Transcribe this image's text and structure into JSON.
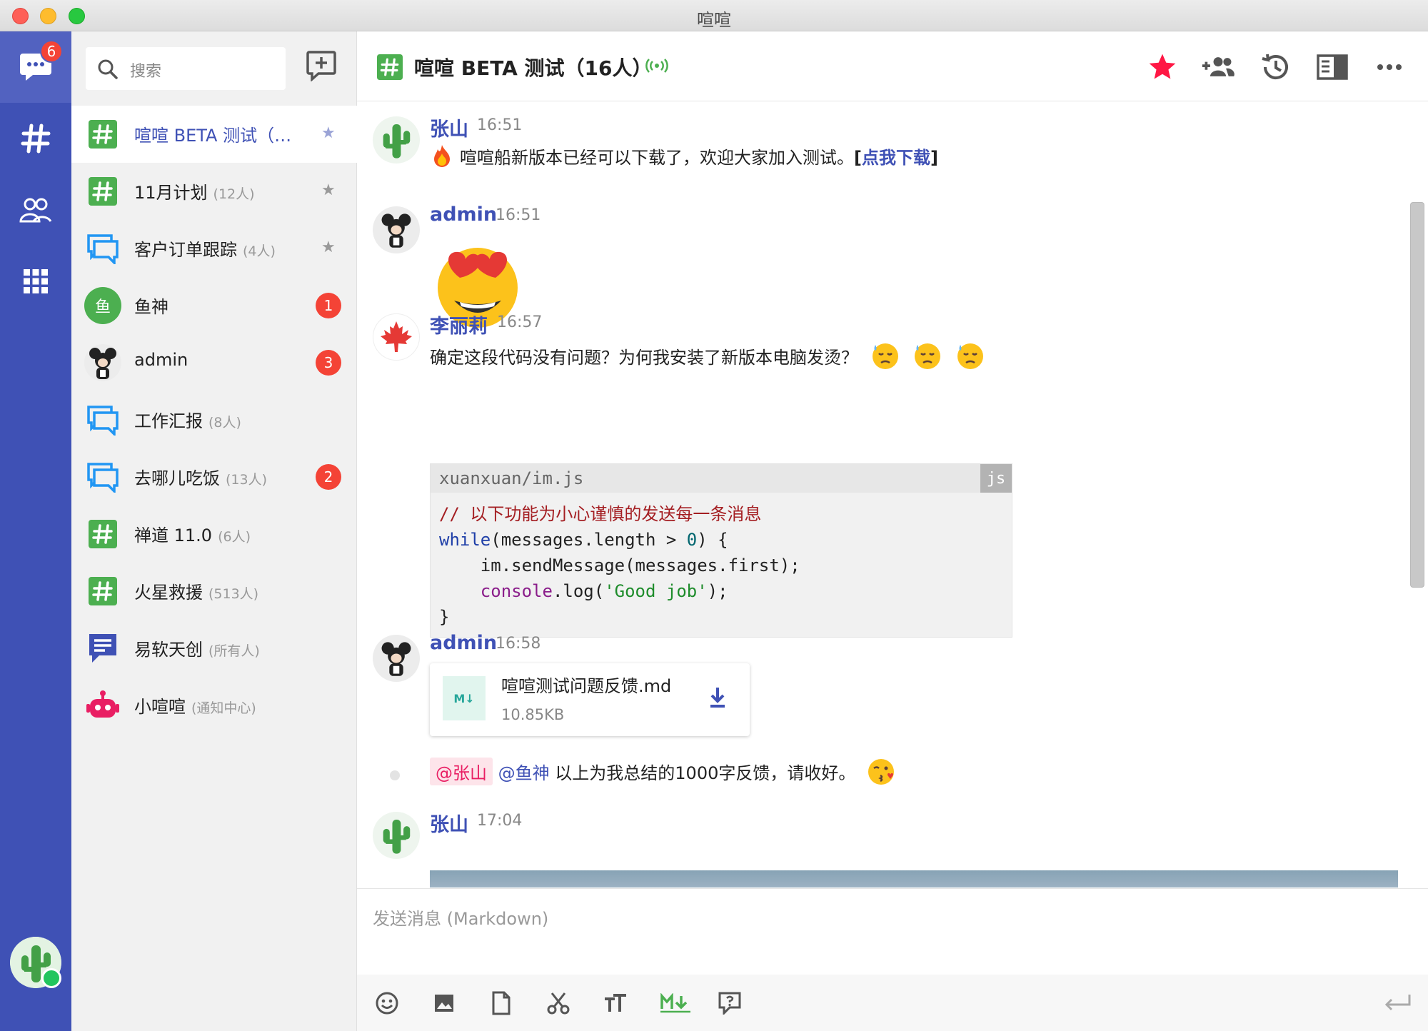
{
  "window": {
    "title": "喧喧"
  },
  "nav": {
    "badge": "6",
    "items": [
      "chat-icon",
      "hashtag-icon",
      "contacts-icon",
      "apps-icon"
    ]
  },
  "search": {
    "placeholder": "搜索"
  },
  "chats": [
    {
      "name": "喧喧 BETA 测试（16人）",
      "count": "",
      "type": "channel",
      "starred": true,
      "active": true
    },
    {
      "name": "11月计划",
      "count": "(12人)",
      "type": "channel",
      "starred": true
    },
    {
      "name": "客户订单跟踪",
      "count": "(4人)",
      "type": "group",
      "starred": true
    },
    {
      "name": "鱼神",
      "count": "",
      "type": "user",
      "avatar_text": "鱼",
      "unread": "1"
    },
    {
      "name": "admin",
      "count": "",
      "type": "user",
      "unread": "3"
    },
    {
      "name": "工作汇报",
      "count": "(8人)",
      "type": "group"
    },
    {
      "name": "去哪儿吃饭",
      "count": "(13人)",
      "type": "group",
      "unread": "2"
    },
    {
      "name": "禅道 11.0",
      "count": "(6人)",
      "type": "channel"
    },
    {
      "name": "火星救援",
      "count": "(513人)",
      "type": "channel"
    },
    {
      "name": "易软天创",
      "count": "(所有人)",
      "type": "system"
    },
    {
      "name": "小喧喧",
      "count": "(通知中心)",
      "type": "robot"
    }
  ],
  "header": {
    "title": "喧喧 BETA 测试（16人）",
    "actions": [
      "star-icon",
      "add-member-icon",
      "history-icon",
      "sidebar-toggle-icon",
      "more-icon"
    ]
  },
  "messages": {
    "m1": {
      "sender": "张山",
      "time": "16:51",
      "text": "喧喧船新版本已经可以下载了，欢迎大家加入测试。",
      "link_open": "[",
      "link": "点我下载",
      "link_close": "]"
    },
    "m2": {
      "sender": "admin",
      "time": "16:51",
      "emoji": "heart-eyes-emoji"
    },
    "m3": {
      "sender": "李丽莉",
      "time": "16:57",
      "text": "确定这段代码没有问题？为何我安装了新版本电脑发烫？",
      "code": {
        "filename": "xuanxuan/im.js",
        "lang": "js",
        "comment": "// 以下功能为小心谨慎的发送每一条消息",
        "l2_kw": "while",
        "l2_a": "(messages.length > ",
        "l2_num": "0",
        "l2_b": ") {",
        "l3": "    im.sendMessage(messages.first);",
        "l4_pre": "    ",
        "l4_fn": "console",
        "l4_a": ".log(",
        "l4_str": "'Good job'",
        "l4_b": ");",
        "l5": "}"
      }
    },
    "m4": {
      "sender": "admin",
      "time": "16:58",
      "file_name": "喧喧测试问题反馈.md",
      "file_size": "10.85KB",
      "file_badge": "M↓"
    },
    "m5": {
      "mention1": "@张山",
      "mention2": "@鱼神",
      "text": "以上为我总结的1000字反馈，请收好。"
    },
    "m6": {
      "sender": "张山",
      "time": "17:04"
    }
  },
  "composer": {
    "placeholder": "发送消息 (Markdown)",
    "tools": [
      "emoji-icon",
      "image-icon",
      "file-icon",
      "scissors-icon",
      "text-size-icon",
      "markdown-icon",
      "help-icon"
    ]
  },
  "colors": {
    "primary": "#3f51b5",
    "accent": "#f44336",
    "channel": "#4caf50",
    "group": "#2196f3",
    "robot": "#e91e63",
    "star": "#ff1744"
  }
}
